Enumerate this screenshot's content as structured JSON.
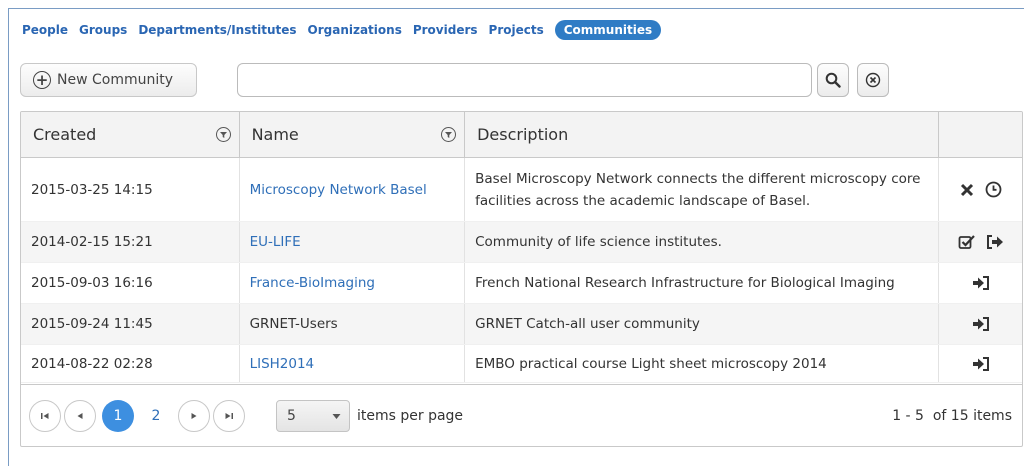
{
  "nav": {
    "items": [
      "People",
      "Groups",
      "Departments/Institutes",
      "Organizations",
      "Providers",
      "Projects",
      "Communities"
    ],
    "active": "Communities"
  },
  "toolbar": {
    "new_label": "New Community",
    "search_value": "",
    "search_placeholder": ""
  },
  "table": {
    "headers": {
      "created": "Created",
      "name": "Name",
      "description": "Description"
    },
    "rows": [
      {
        "created": "2015-03-25 14:15",
        "name": "Microscopy Network Basel",
        "name_is_link": true,
        "description": "Basel Microscopy Network connects the different microscopy core facilities across the academic landscape of Basel.",
        "actions": [
          "close-icon",
          "clock-icon"
        ]
      },
      {
        "created": "2014-02-15 15:21",
        "name": "EU-LIFE",
        "name_is_link": true,
        "description": "Community of life science institutes.",
        "actions": [
          "checked-box-icon",
          "sign-out-icon"
        ]
      },
      {
        "created": "2015-09-03 16:16",
        "name": "France-BioImaging",
        "name_is_link": true,
        "description": "French National Research Infrastructure for Biological Imaging",
        "actions": [
          "sign-in-icon"
        ]
      },
      {
        "created": "2015-09-24 11:45",
        "name": "GRNET-Users",
        "name_is_link": false,
        "description": "GRNET Catch-all user community",
        "actions": [
          "sign-in-icon"
        ]
      },
      {
        "created": "2014-08-22 02:28",
        "name": "LISH2014",
        "name_is_link": true,
        "description": "EMBO practical course Light sheet microscopy 2014",
        "actions": [
          "sign-in-icon"
        ]
      }
    ]
  },
  "pager": {
    "pages": [
      "1",
      "2"
    ],
    "current": "1",
    "page_size": "5",
    "items_per_page_label": "items per page",
    "info": "1 - 5  of 15 items"
  },
  "colors": {
    "accent": "#2f7cc5",
    "link": "#2f6fb8",
    "active_page": "#3d8fe0"
  }
}
